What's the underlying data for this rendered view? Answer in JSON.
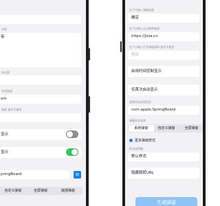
{
  "colors": {
    "toggle_on": "#34c759",
    "toggle_off": "#8e8e93",
    "accent": "#1a7ef0",
    "primary_button": "#8fc3f5",
    "background": "#f2f2f5"
  },
  "left_screen": {
    "fragments": {
      "f1": "",
      "f2": "内容",
      "f3": "",
      "f4": "容",
      "f5": "的内容",
      "f6": "",
      "f7": "包名链接",
      "f8": ""
    },
    "url_partial": "om",
    "hint_partial": "链接 留空不使用",
    "toggle1": {
      "label": "显示",
      "on": false
    },
    "toggle2": {
      "label": "显示",
      "on": true
    },
    "bundle_partial": "pringBoard",
    "bundle_btn_icon": "list-icon",
    "tabs": [
      "自定义弹窗",
      "全屏弹窗",
      "底部弹窗"
    ]
  },
  "right_screen": {
    "label_title": "在下方输入弹窗标题",
    "title_value": "确定",
    "label_url": "在下方输入点击跳转链接",
    "url_value": "https://jisla.cn",
    "label_password": "在下方输入打开弹窗密码 留空不使用",
    "password_placeholder": "密码",
    "timed_display": "启用时间控制显示",
    "first_launch": "仅首次启动显示",
    "label_bundle": "选择目标应用包名",
    "bundle_value": "com.apple.SpringBoard",
    "label_style": "弹窗样式选择",
    "tabs": [
      "系统弹窗",
      "自定义弹窗",
      "全屏弹窗"
    ],
    "selected_tab": "系统弹窗",
    "more_styles": "更多弹窗样式",
    "label_style2": "样式选择器",
    "default_style": "默认样式",
    "hide_redirect": "隐藏跳转URL",
    "generate_button": "生成弹窗"
  }
}
